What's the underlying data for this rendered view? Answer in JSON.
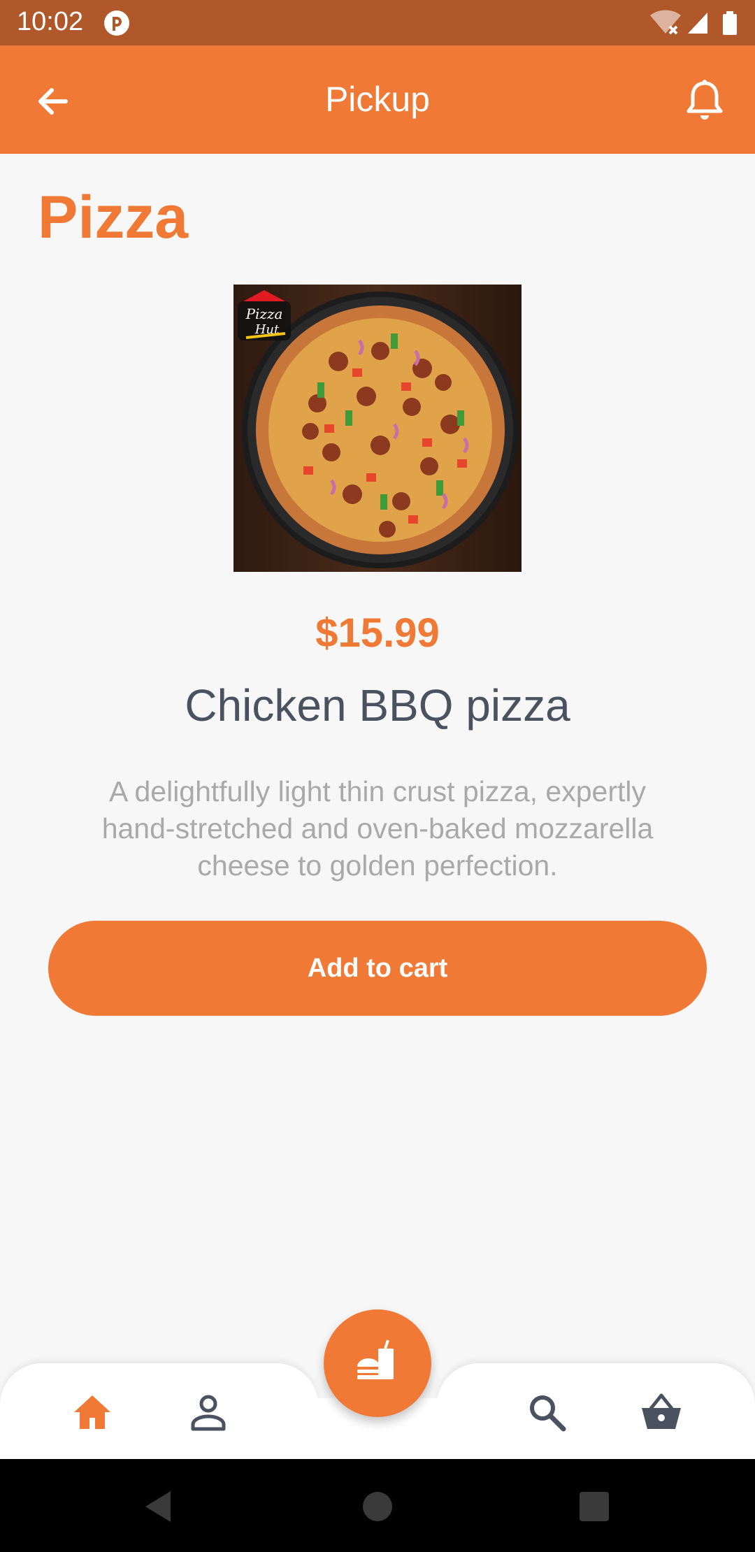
{
  "status_bar": {
    "time": "10:02"
  },
  "app_bar": {
    "title": "Pickup",
    "back_icon": "arrow-left-icon",
    "notification_icon": "bell-icon"
  },
  "category": {
    "title": "Pizza"
  },
  "product": {
    "price": "$15.99",
    "name": "Chicken BBQ pizza",
    "description": "A delightfully light thin crust pizza, expertly hand-stretched and oven-baked mozzarella cheese to golden perfection.",
    "image_label": "Pizza Hut"
  },
  "actions": {
    "add_to_cart_label": "Add to cart"
  },
  "bottom_nav": {
    "items": [
      {
        "icon": "home-icon",
        "active": true
      },
      {
        "icon": "person-icon",
        "active": false
      },
      {
        "icon": "food-icon",
        "active": false
      },
      {
        "icon": "search-icon",
        "active": false
      },
      {
        "icon": "basket-icon",
        "active": false
      }
    ]
  },
  "colors": {
    "accent": "#f07a35",
    "status_bar": "#b0582a",
    "text_dark": "#4a5260",
    "text_muted": "#a9a9a9",
    "background": "#f7f7f7"
  }
}
